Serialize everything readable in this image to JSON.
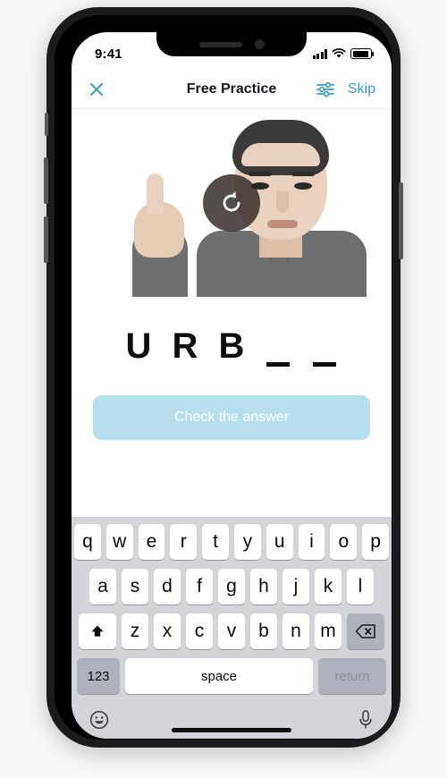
{
  "status_bar": {
    "time": "9:41",
    "signal_icon": "cellular-bars-icon",
    "wifi_icon": "wifi-icon",
    "battery_icon": "battery-full-icon"
  },
  "nav": {
    "close_icon": "close-icon",
    "title": "Free Practice",
    "settings_icon": "sliders-settings-icon",
    "skip_label": "Skip"
  },
  "video": {
    "replay_icon": "replay-icon",
    "description": "Sign language instructor video"
  },
  "answer": {
    "slots": [
      {
        "type": "letter",
        "value": "U"
      },
      {
        "type": "letter",
        "value": "R"
      },
      {
        "type": "letter",
        "value": "B"
      },
      {
        "type": "blank",
        "value": "_"
      },
      {
        "type": "blank",
        "value": "_"
      }
    ]
  },
  "check_button": {
    "label": "Check the answer",
    "enabled": false,
    "background": "#b7e0ef",
    "text_color": "#ffffff"
  },
  "keyboard": {
    "row1": [
      "q",
      "w",
      "e",
      "r",
      "t",
      "y",
      "u",
      "i",
      "o",
      "p"
    ],
    "row2": [
      "a",
      "s",
      "d",
      "f",
      "g",
      "h",
      "j",
      "k",
      "l"
    ],
    "row3": [
      "z",
      "x",
      "c",
      "v",
      "b",
      "n",
      "m"
    ],
    "shift_icon": "shift-arrow-icon",
    "backspace_icon": "backspace-delete-icon",
    "numbers_label": "123",
    "space_label": "space",
    "return_label": "return",
    "emoji_icon": "emoji-smiley-icon",
    "dictation_icon": "microphone-icon"
  },
  "colors": {
    "accent": "#3d9fc0",
    "keyboard_bg": "#d2d4da",
    "key_bg": "#ffffff",
    "modifier_key_bg": "#adb1bb"
  }
}
